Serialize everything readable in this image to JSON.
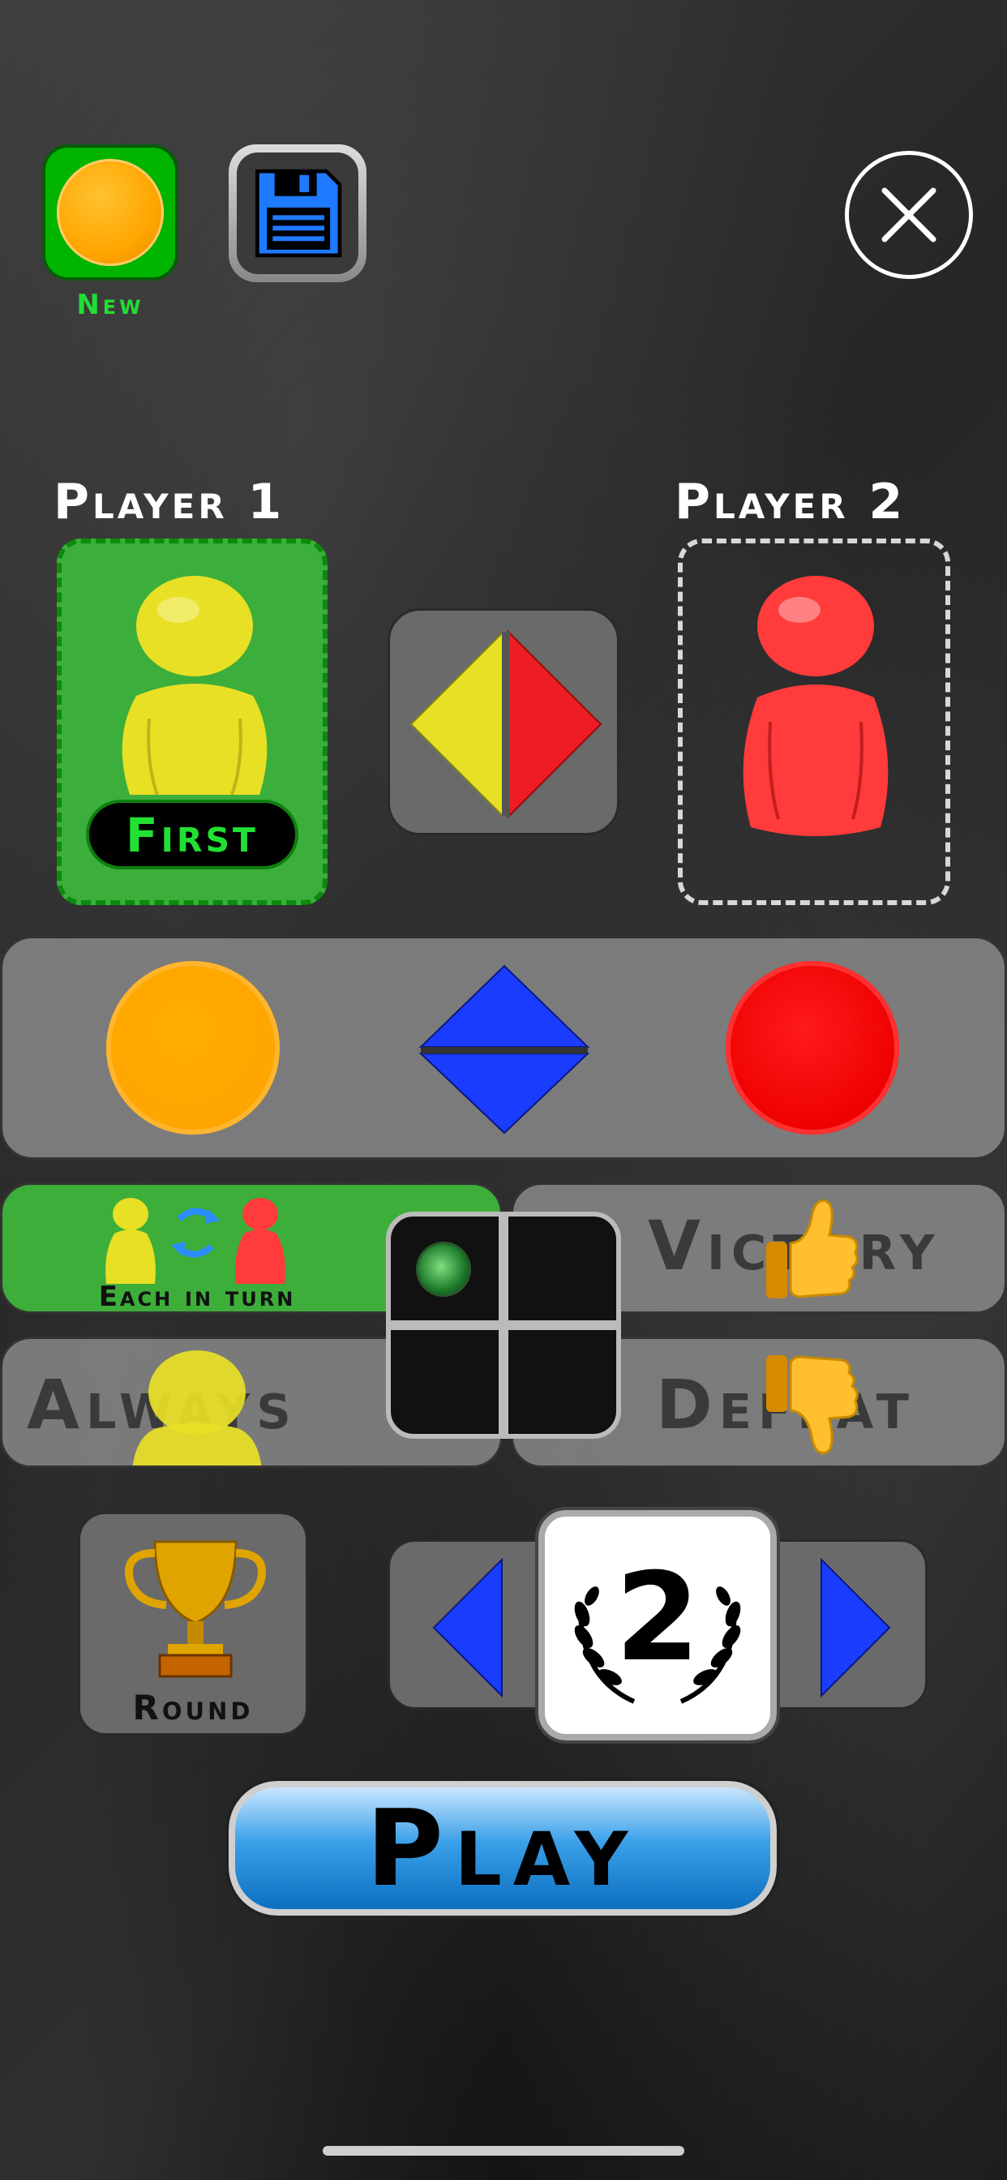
{
  "top": {
    "new_label": "New"
  },
  "players": {
    "p1_title": "Player 1",
    "p2_title": "Player 2",
    "first_badge": "First",
    "p1_color": "#e8e025",
    "p2_color": "#ff3b3b"
  },
  "options": {
    "each_in_turn": "Each in turn",
    "always": "Always",
    "victory": "Victory",
    "defeat": "Defeat"
  },
  "round": {
    "label": "Round",
    "count": "2"
  },
  "play_label": "Play",
  "colors": {
    "accent_green": "#3dae3a",
    "coin_orange": "#ffa500",
    "coin_red": "#ff1010",
    "blue": "#1a3cff"
  }
}
